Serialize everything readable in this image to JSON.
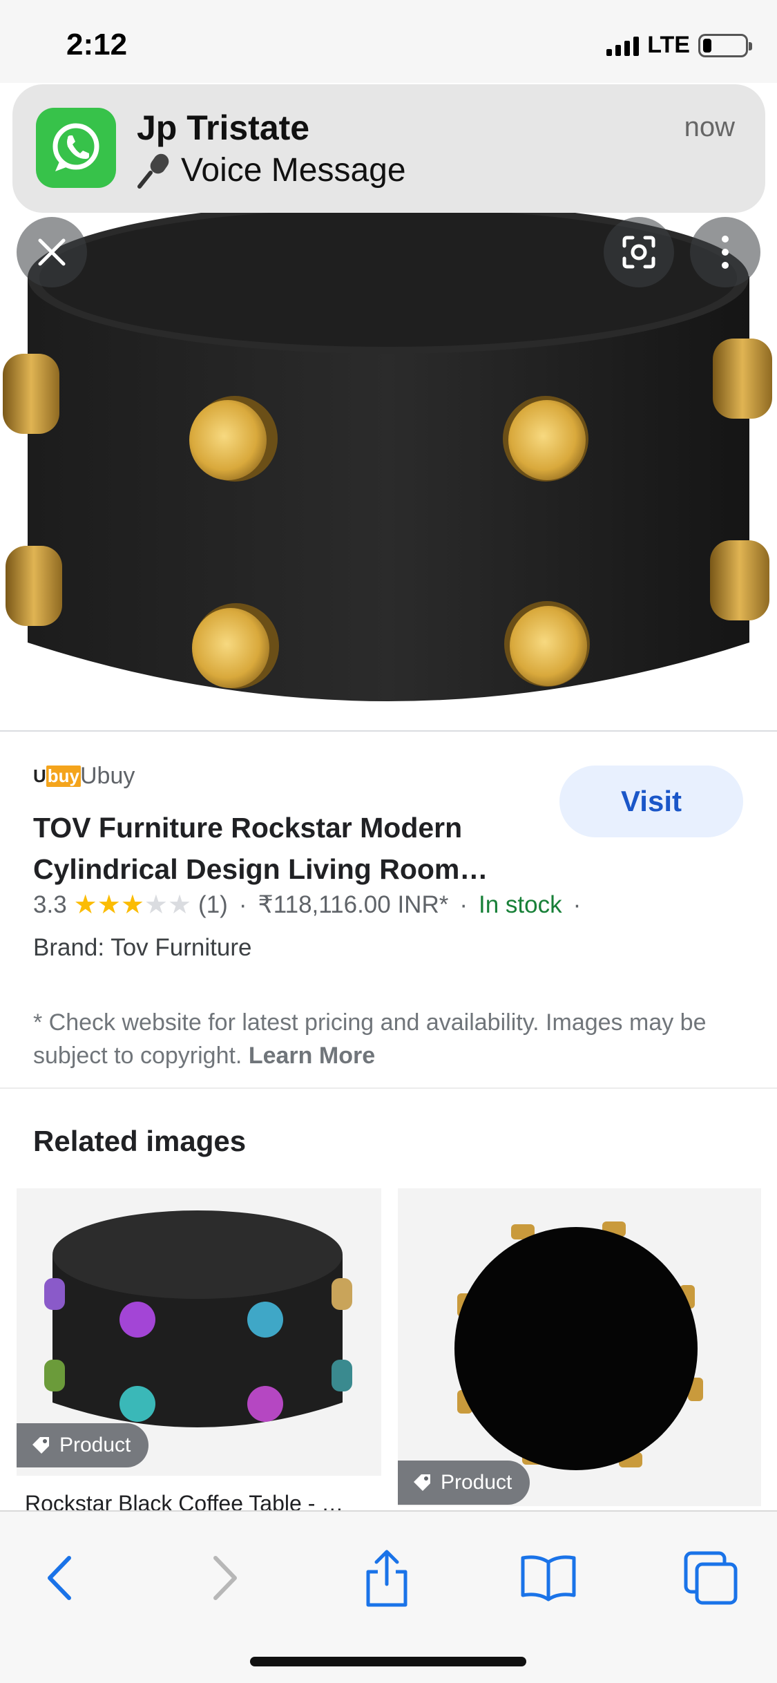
{
  "status_bar": {
    "time": "2:12",
    "network": "LTE",
    "battery_level": 0.2
  },
  "notification": {
    "app_icon": "whatsapp-icon",
    "sender": "Jp Tristate",
    "message": "Voice Message",
    "message_icon": "microphone-icon",
    "time": "now"
  },
  "image_viewer": {
    "close_icon": "close-icon",
    "lens_icon": "google-lens-icon",
    "more_icon": "more-vert-icon"
  },
  "product": {
    "source": "Ubuy",
    "source_logo_text": "Ubuy",
    "visit_label": "Visit",
    "title": "TOV Furniture Rockstar Modern Cylindrical Design Living Room…",
    "rating": "3.3",
    "rating_value": 3.3,
    "review_count": "(1)",
    "separator": "·",
    "price": "₹118,116.00 INR*",
    "availability": "In stock",
    "brand": "Brand: Tov Furniture",
    "disclaimer": "* Check website for latest pricing and availability. Images may be subject to copyright.",
    "learn_more": "Learn More"
  },
  "related": {
    "heading": "Related images",
    "items": [
      {
        "badge": "Product",
        "caption": "Rockstar Black Coffee Table - …"
      },
      {
        "badge": "Product",
        "caption": ""
      }
    ]
  },
  "toolbar": {
    "back_icon": "back-arrow-icon",
    "forward_icon": "forward-arrow-icon",
    "share_icon": "share-icon",
    "bookmarks_icon": "bookmarks-book-icon",
    "tabs_icon": "tabs-icon"
  },
  "colors": {
    "visit_bg": "#e8f0fe",
    "visit_text": "#1a56c8",
    "in_stock": "#188038",
    "star": "#fbbc04",
    "ios_blue": "#1a73e8"
  }
}
